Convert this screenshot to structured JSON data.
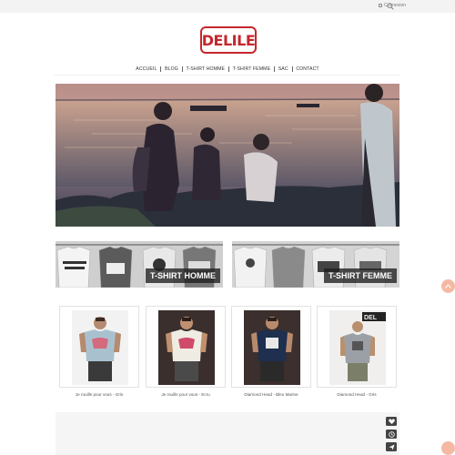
{
  "topbar": {
    "login_label": "Connexion"
  },
  "logo": {
    "text": "DELILE"
  },
  "nav": {
    "items": [
      {
        "label": "ACCUEIL"
      },
      {
        "label": "BLOG"
      },
      {
        "label": "T-SHIRT HOMME"
      },
      {
        "label": "T-SHIRT FEMME"
      },
      {
        "label": "SAC"
      },
      {
        "label": "CONTACT"
      }
    ]
  },
  "categories": [
    {
      "label": "T-SHIRT HOMME"
    },
    {
      "label": "T-SHIRT FEMME"
    }
  ],
  "products": [
    {
      "title": "Je rouille pour vous - Gris",
      "shirt_color": "#a9c1cf"
    },
    {
      "title": "Je rouille pour vous - Ecru",
      "shirt_color": "#efece4"
    },
    {
      "title": "Diamond Head - Bleu Marine",
      "shirt_color": "#1e2f4f"
    },
    {
      "title": "Diamond Head - Gris",
      "shirt_color": "#9aa0a5"
    }
  ],
  "colors": {
    "brand": "#c4272d",
    "accent": "#f5b9a3"
  }
}
